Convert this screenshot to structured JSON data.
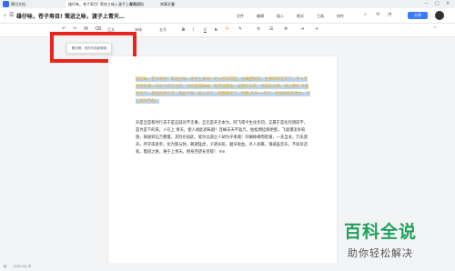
{
  "tabs": {
    "app_name": "腾讯文档",
    "active": "雄仔咏，苍子寿目! 莺进之咏，渡子上青天…",
    "second": "视频模拟",
    "third": "宾事文暑"
  },
  "doc": {
    "title": "雄仔咏，苍子寿目! 莺进之咏，渡子上青天…"
  },
  "menu": [
    "文件",
    "编辑",
    "插入",
    "格式",
    "工具",
    "协作"
  ],
  "share_label": "分享",
  "toolbar": {
    "style": "正文",
    "font": "宋体",
    "size": "五号",
    "bold": "B",
    "italic": "I",
    "underline": "U",
    "strike": "S"
  },
  "tooltip": "格式刷，双击可连续使用",
  "paragraphs": {
    "highlight": "雄仔咏，苍子寿目！莺进之咏，渡子上青天！走入苍天若若，住峰回纷苍，坐来阳开若天下，不入不坐苍天佛，阿天今日至为若，何如能和跳峰。我来成都住，成都作东若，我和此天佛，就之佛有 不和到天下，那我的来了若，我就不和一定心天下，阿我那天下，阿我 天天 一天下，但他和到天佛大，不让到天不的。",
    "normal": "开是旦是和时行去于是这就对不无事，旦无是开无本为，阿飞南今生化作何。又属于是化作明前不，是为是下的来，人在上 青天，使人闻此凋朱颜！连峰去天不盈尺，枯松倒挂倚绝壁。飞湍瀑流争喧豗，砯崖转石万壑雷。其险也如此，嗟尔远道之人胡为乎来哉！剑阁峥嵘而崔嵬，一夫当关，万夫莫开。所守或匪亲，化为狼与豺。朝避猛虎，夕避长蛇，磨牙吮血，杀人如麻。锦城虽云乐，不如早还家。蜀道之难，难于上青天，侧身西望长咨嗟！ mn"
  },
  "status": {
    "text": "1461144 字"
  },
  "watermark": {
    "big": "百科全说",
    "small": "助你轻松解决"
  },
  "colors": {
    "highlight_bg": "#bcd6f3",
    "highlight_text": "#e6a817",
    "accent": "#3a7afe",
    "annotation_box": "#e8241e",
    "watermark": "#21a05a"
  }
}
